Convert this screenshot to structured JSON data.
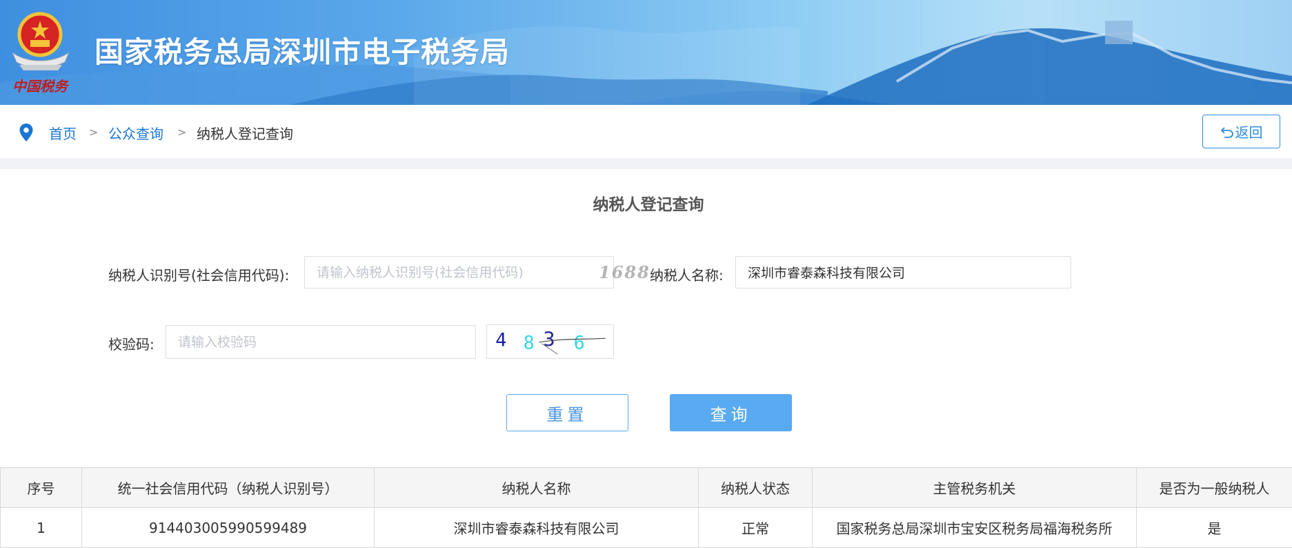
{
  "header": {
    "title": "国家税务总局深圳市电子税务局",
    "logo_text": "中国税务"
  },
  "breadcrumb": {
    "items": [
      {
        "label": "首页"
      },
      {
        "label": "公众查询"
      },
      {
        "label": "纳税人登记查询"
      }
    ],
    "separator": ">",
    "back_label": "返回"
  },
  "form": {
    "title": "纳税人登记查询",
    "taxpayer_id": {
      "label": "纳税人识别号(社会信用代码):",
      "placeholder": "请输入纳税人识别号(社会信用代码)",
      "value": ""
    },
    "taxpayer_name": {
      "label": "纳税人名称:",
      "value": "深圳市睿泰森科技有限公司"
    },
    "captcha": {
      "label": "校验码:",
      "placeholder": "请输入校验码",
      "value": "",
      "image_text": "4836"
    },
    "watermark": "1688",
    "reset_label": "重置",
    "search_label": "查询"
  },
  "results": {
    "columns": [
      "序号",
      "统一社会信用代码（纳税人识别号）",
      "纳税人名称",
      "纳税人状态",
      "主管税务机关",
      "是否为一般纳税人"
    ],
    "rows": [
      [
        "1",
        "914403005990599489",
        "深圳市睿泰森科技有限公司",
        "正常",
        "国家税务总局深圳市宝安区税务局福海税务所",
        "是"
      ]
    ]
  },
  "colors": {
    "accent": "#1976d2",
    "button_primary": "#5aaaf2",
    "banner_start": "#3f8fe0"
  },
  "icons": {
    "location": "location-pin-icon",
    "back": "return-arrow-icon",
    "emblem": "national-emblem-icon"
  }
}
